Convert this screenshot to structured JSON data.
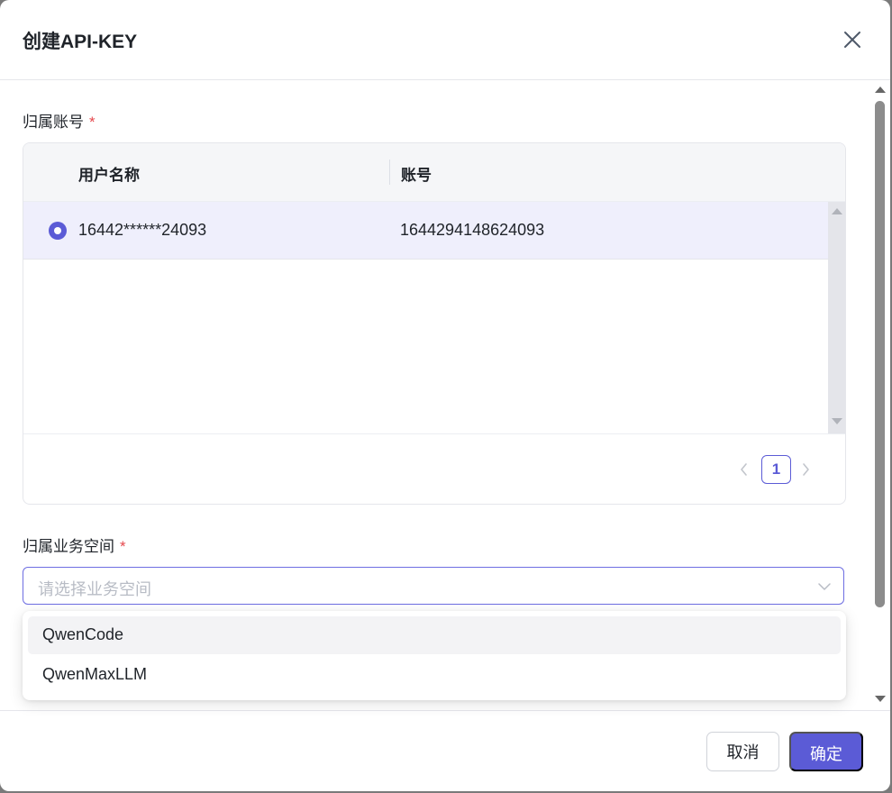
{
  "dialog": {
    "title": "创建API-KEY",
    "close_icon": "close-icon"
  },
  "account_section": {
    "label": "归属账号",
    "required_mark": "*",
    "table": {
      "columns": [
        "用户名称",
        "账号"
      ],
      "rows": [
        {
          "selected": true,
          "username": "16442******24093",
          "account": "1644294148624093"
        }
      ]
    },
    "pagination": {
      "current_page": "1",
      "prev_icon": "chevron-left-icon",
      "next_icon": "chevron-right-icon"
    }
  },
  "workspace_section": {
    "label": "归属业务空间",
    "required_mark": "*",
    "select": {
      "placeholder": "请选择业务空间",
      "icon": "chevron-down-icon"
    },
    "options": [
      "QwenCode",
      "QwenMaxLLM"
    ]
  },
  "footer": {
    "cancel_label": "取消",
    "ok_label": "确定"
  },
  "colors": {
    "accent": "#5b5bd6",
    "selected_row": "#efeffc",
    "required": "#e5484d"
  }
}
